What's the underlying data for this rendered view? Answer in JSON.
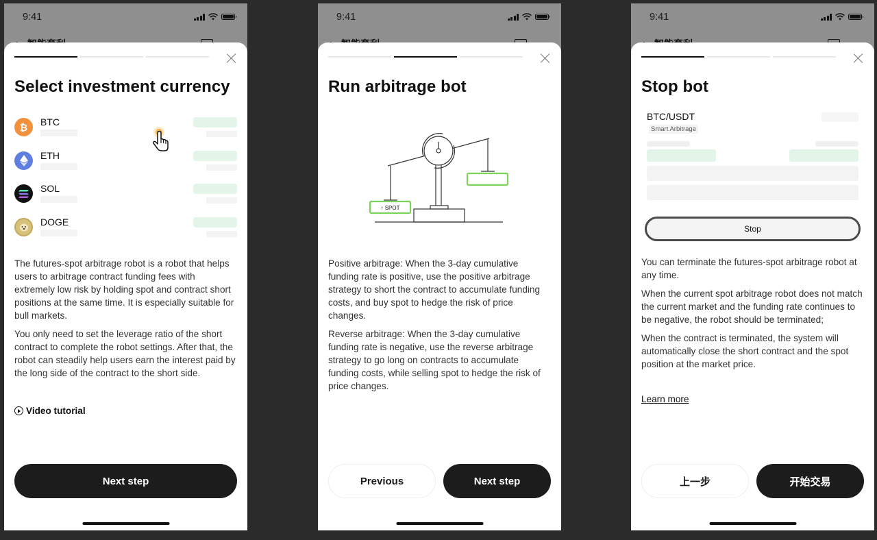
{
  "status_bar": {
    "time": "9:41"
  },
  "background_page": {
    "title": "智能套利"
  },
  "screens": [
    {
      "step": 1,
      "total_steps": 3,
      "title": "Select investment currency",
      "coins": [
        {
          "symbol": "BTC",
          "icon": "bitcoin-icon",
          "color": "#f1913b"
        },
        {
          "symbol": "ETH",
          "icon": "ethereum-icon",
          "color": "#5f7ee0"
        },
        {
          "symbol": "SOL",
          "icon": "solana-icon",
          "color": "#111111"
        },
        {
          "symbol": "DOGE",
          "icon": "dogecoin-icon",
          "color": "#d7c27c"
        }
      ],
      "paragraphs": [
        "The futures-spot arbitrage robot is a robot that helps users to arbitrage contract funding fees with extremely low risk by holding spot and contract short positions at the same time. It is especially suitable for bull markets.",
        "You only need to set the leverage ratio of the short contract to complete the robot settings. After that, the robot can steadily help users earn the interest paid by the long side of the contract to the short side."
      ],
      "video_link": "Video tutorial",
      "primary_button": "Next step"
    },
    {
      "step": 2,
      "total_steps": 3,
      "title": "Run arbitrage bot",
      "illustration": {
        "label": "SPOT",
        "arrow": "↑"
      },
      "paragraphs": [
        "Positive arbitrage: When the 3-day cumulative funding rate is positive, use the positive arbitrage strategy to short the contract to accumulate funding costs, and buy spot to hedge the risk of price changes.",
        "Reverse arbitrage: When the 3-day cumulative funding rate is negative, use the reverse arbitrage strategy to go long on contracts to accumulate funding costs, while selling spot to hedge the risk of price changes."
      ],
      "secondary_button": "Previous",
      "primary_button": "Next step"
    },
    {
      "step": 1,
      "total_steps": 3,
      "title": "Stop bot",
      "bot_card": {
        "pair": "BTC/USDT",
        "tag": "Smart Arbitrage",
        "stop_label": "Stop"
      },
      "paragraphs": [
        "You can terminate the futures-spot arbitrage robot at any time.",
        "When the current spot arbitrage robot does not match the current market and the funding rate continues to be negative, the robot should be terminated;",
        "When the contract is terminated, the system will automatically close the short contract and the spot position at the market price."
      ],
      "learn_more": "Learn more",
      "secondary_button": "上一步",
      "primary_button": "开始交易"
    }
  ],
  "colors": {
    "primary_button": "#1c1c1c",
    "skeleton_green": "#e3f5e8",
    "skeleton_gray": "#f3f3f3",
    "spot_box_green": "#7bd35a",
    "pointer_highlight": "#f5a623"
  }
}
